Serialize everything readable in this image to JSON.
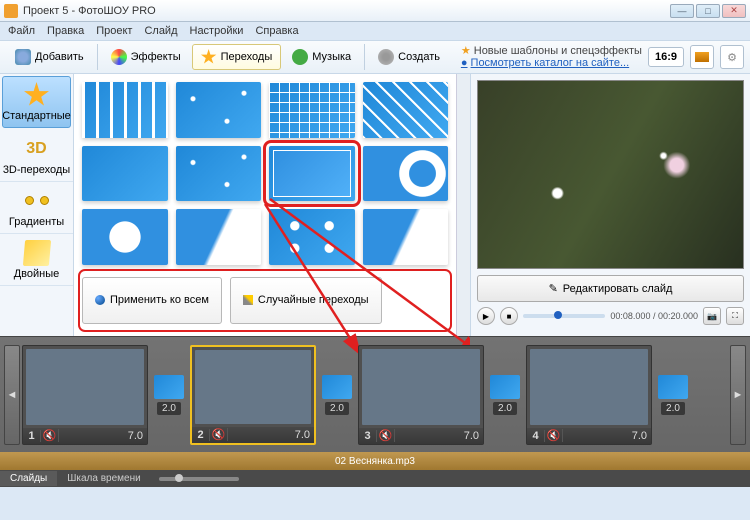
{
  "window": {
    "title": "Проект 5 - ФотоШОУ PRO"
  },
  "menu": [
    "Файл",
    "Правка",
    "Проект",
    "Слайд",
    "Настройки",
    "Справка"
  ],
  "toolbar": {
    "add": "Добавить",
    "effects": "Эффекты",
    "transitions": "Переходы",
    "music": "Музыка",
    "create": "Создать"
  },
  "promo": {
    "line1": "Новые шаблоны и спецэффекты",
    "line2": "Посмотреть каталог на сайте..."
  },
  "aspect": "16:9",
  "categories": {
    "standard": "Стандартные",
    "threed": "3D-переходы",
    "threed_icon": "3D",
    "gradients": "Градиенты",
    "double": "Двойные"
  },
  "actions": {
    "applyAll": "Применить ко всем",
    "random": "Случайные переходы"
  },
  "preview": {
    "edit": "Редактировать слайд",
    "time": "00:08.000 / 00:20.000"
  },
  "timeline": {
    "slides": [
      {
        "num": "1",
        "dur": "7.0"
      },
      {
        "num": "2",
        "dur": "7.0"
      },
      {
        "num": "3",
        "dur": "7.0"
      },
      {
        "num": "4",
        "dur": "7.0"
      }
    ],
    "transDur": "2.0",
    "audio": "02 Веснянка.mp3",
    "tabs": {
      "slides": "Слайды",
      "timeline": "Шкала времени"
    }
  }
}
